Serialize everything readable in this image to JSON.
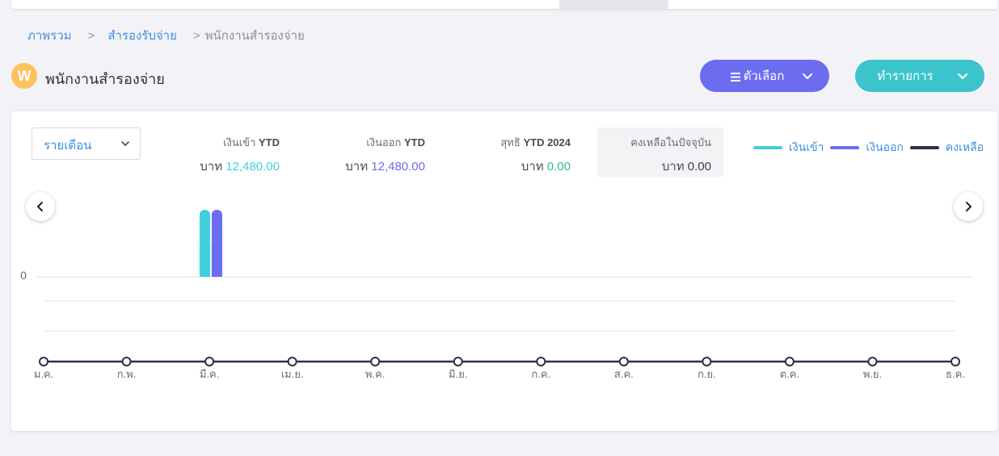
{
  "breadcrumb": {
    "items": [
      "ภาพรวม",
      "สำรองรับจ่าย",
      "พนักงานสำรองจ่าย"
    ],
    "separator": ">"
  },
  "header": {
    "avatar_letter": "W",
    "title": "พนักงานสำรองจ่าย",
    "options_label": "ตัวเลือก",
    "action_label": "ทำรายการ"
  },
  "filter": {
    "period": "รายเดือน"
  },
  "stats": {
    "income": {
      "label": "เงินเข้า",
      "tag": "YTD",
      "currency": "บาท",
      "value": "12,480.00"
    },
    "expense": {
      "label": "เงินออก",
      "tag": "YTD",
      "currency": "บาท",
      "value": "12,480.00"
    },
    "net": {
      "label": "สุทธิ",
      "tag": "YTD 2024",
      "currency": "บาท",
      "value": "0.00"
    },
    "balance": {
      "label": "คงเหลือในปัจจุบัน",
      "currency": "บาท",
      "value": "0.00"
    }
  },
  "colors": {
    "income": "#3fd0dc",
    "expense": "#6c6cf0",
    "balance": "#2e2e4e",
    "net": "#32c080",
    "link": "#3d8fe0"
  },
  "chart_data": {
    "type": "bar",
    "categories": [
      "ม.ค.",
      "ก.พ.",
      "มี.ค.",
      "เม.ย.",
      "พ.ค.",
      "มิ.ย.",
      "ก.ค.",
      "ส.ค.",
      "ก.ย.",
      "ต.ค.",
      "พ.ย.",
      "ธ.ค."
    ],
    "series": [
      {
        "name": "เงินเข้า",
        "values": [
          0,
          0,
          12480,
          0,
          0,
          0,
          0,
          0,
          0,
          0,
          0,
          0
        ]
      },
      {
        "name": "เงินออก",
        "values": [
          0,
          0,
          12480,
          0,
          0,
          0,
          0,
          0,
          0,
          0,
          0,
          0
        ]
      },
      {
        "name": "คงเหลือ",
        "values": [
          0,
          0,
          0,
          0,
          0,
          0,
          0,
          0,
          0,
          0,
          0,
          0
        ]
      }
    ],
    "y_tick_label": "0",
    "legend": "top-right"
  }
}
